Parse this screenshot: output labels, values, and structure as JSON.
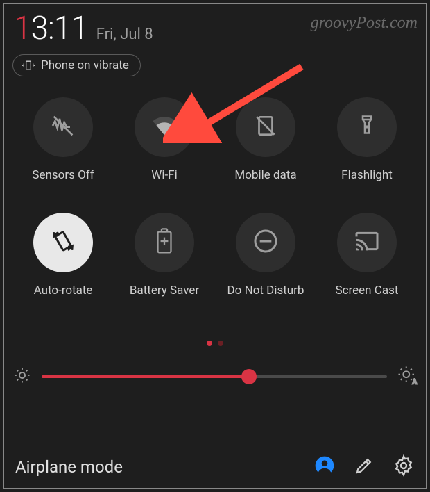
{
  "time": {
    "hour_first": "1",
    "hour_rest": "3:11"
  },
  "date": "Fri, Jul 8",
  "watermark": "groovyPost.com",
  "vibrate_chip": {
    "label": "Phone on vibrate"
  },
  "tiles": [
    {
      "label": "Sensors Off",
      "icon": "sensors-off",
      "active": false
    },
    {
      "label": "Wi-Fi",
      "icon": "wifi",
      "active": false
    },
    {
      "label": "Mobile data",
      "icon": "mobile-data-off",
      "active": false
    },
    {
      "label": "Flashlight",
      "icon": "flashlight",
      "active": false
    },
    {
      "label": "Auto-rotate",
      "icon": "auto-rotate",
      "active": true
    },
    {
      "label": "Battery Saver",
      "icon": "battery-saver",
      "active": false
    },
    {
      "label": "Do Not Disturb",
      "icon": "do-not-disturb",
      "active": false
    },
    {
      "label": "Screen Cast",
      "icon": "cast",
      "active": false
    }
  ],
  "page_indicator": {
    "count": 2,
    "active": 0
  },
  "brightness": {
    "percent": 60
  },
  "footer": {
    "title": "Airplane mode"
  },
  "colors": {
    "accent": "#d93444",
    "active_bg": "#e8e8e8",
    "tile_bg": "#2e2e2e"
  }
}
